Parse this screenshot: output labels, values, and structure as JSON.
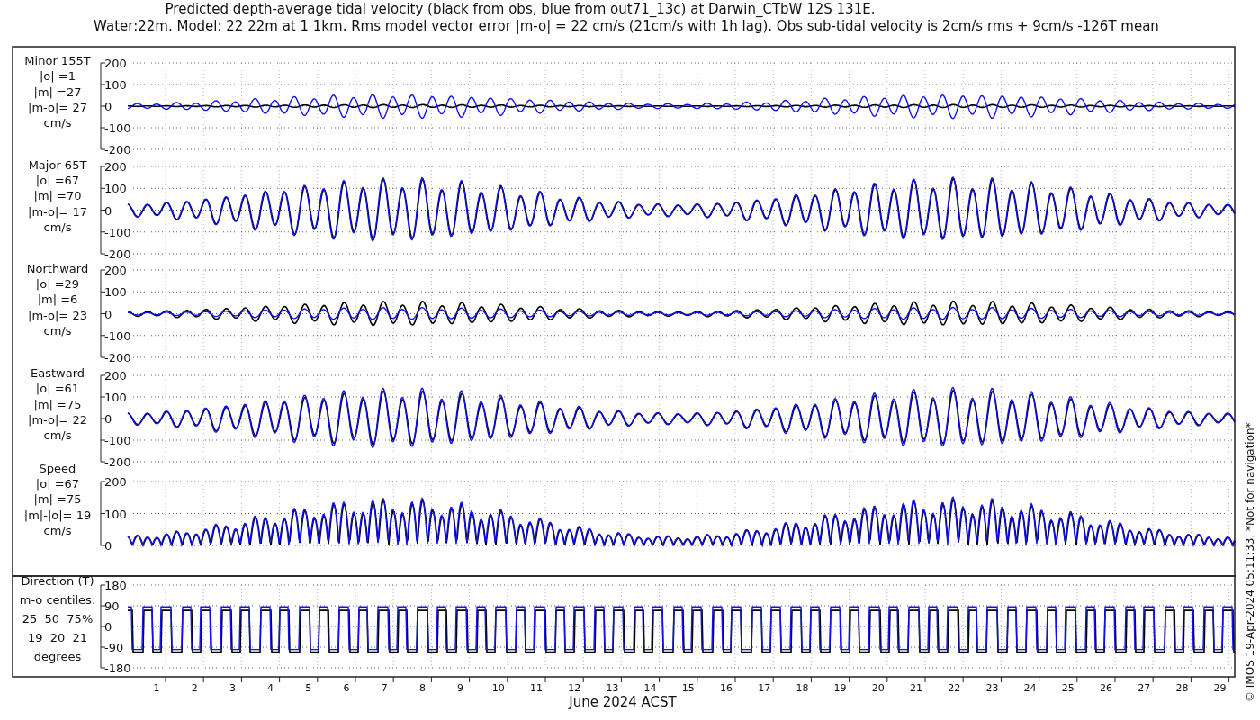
{
  "title": [
    "Predicted depth-average tidal velocity (black from obs, blue from out71_13c) at Darwin_CTbW 12S 131E.",
    "Water:22m. Model: 22 22m at 1 1km. Rms model vector error |m-o| = 22 cm/s (21cm/s with 1h lag). Obs sub-tidal velocity is 2cm/s rms + 9cm/s -126T mean"
  ],
  "panels": [
    {
      "kind": "velocity",
      "label_lines": [
        "Minor 155T",
        "|o| =1",
        "|m| =27",
        "|m-o|= 27",
        "cm/s"
      ],
      "yticks": [
        "200",
        "100",
        "0",
        "-100",
        "-200"
      ]
    },
    {
      "kind": "velocity",
      "label_lines": [
        "Major 65T",
        "|o| =67",
        "|m| =70",
        "|m-o|= 17",
        "cm/s"
      ],
      "yticks": [
        "200",
        "100",
        "0",
        "-100",
        "-200"
      ]
    },
    {
      "kind": "velocity",
      "label_lines": [
        "Northward",
        "|o| =29",
        "|m| =6",
        "|m-o|= 23",
        "cm/s"
      ],
      "yticks": [
        "200",
        "100",
        "0",
        "-100",
        "-200"
      ]
    },
    {
      "kind": "velocity",
      "label_lines": [
        "Eastward",
        "|o| =61",
        "|m| =75",
        "|m-o|= 22",
        "cm/s"
      ],
      "yticks": [
        "200",
        "100",
        "0",
        "-100",
        "-200"
      ]
    },
    {
      "kind": "speed",
      "label_lines": [
        "Speed",
        "|o| =67",
        "|m| =75",
        "|m|-|o|= 19",
        "cm/s"
      ],
      "yticks": [
        "200",
        "100",
        "0"
      ]
    },
    {
      "kind": "direction",
      "label_lines": [
        "Direction (T)",
        "m-o centiles:",
        "25  50  75%",
        "19  20  21",
        "degrees"
      ],
      "yticks": [
        "180",
        "90",
        "0",
        "-90",
        "-180"
      ]
    }
  ],
  "xaxis": {
    "ticks": [
      "1",
      "2",
      "3",
      "4",
      "5",
      "6",
      "7",
      "8",
      "9",
      "10",
      "11",
      "12",
      "13",
      "14",
      "15",
      "16",
      "17",
      "18",
      "19",
      "20",
      "21",
      "22",
      "23",
      "24",
      "25",
      "26",
      "27",
      "28",
      "29"
    ],
    "label": "June 2024 ACST"
  },
  "credit": "© IMOS 19-Apr-2024 05:11:33. *Not for navigation*"
}
